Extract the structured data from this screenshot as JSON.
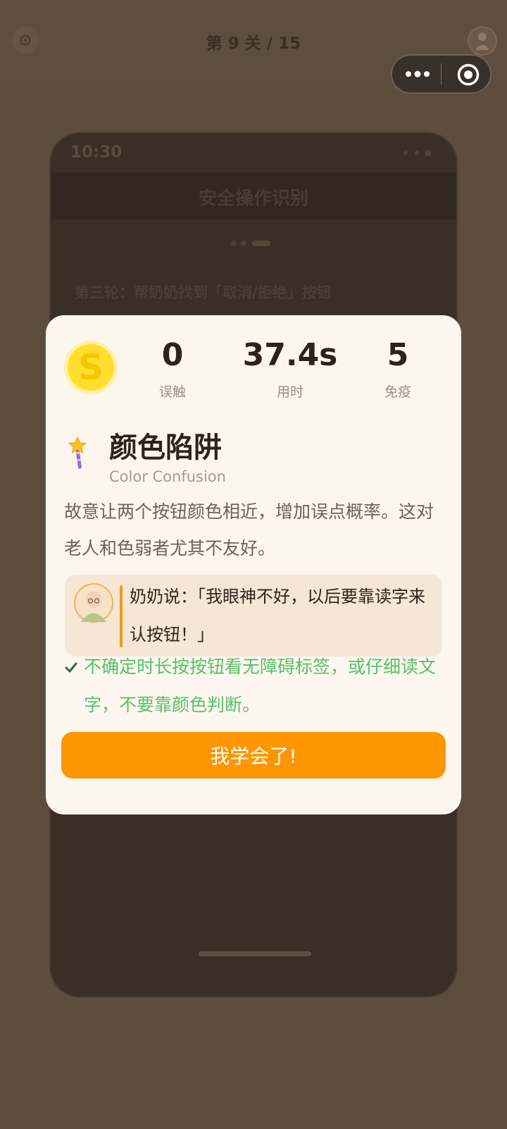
{
  "topbar": {
    "level_title": "第 9 关 / 15"
  },
  "phone": {
    "time": "10:30",
    "header_title": "安全操作识别",
    "question": "第三轮：帮奶奶找到「取消/拒绝」按钮"
  },
  "stats": [
    {
      "value": "0",
      "label": "误触"
    },
    {
      "value": "37.4s",
      "label": "用时"
    },
    {
      "value": "5",
      "label": "免疫"
    }
  ],
  "coin": {
    "letter": "S",
    "color": "#ffd400"
  },
  "trap": {
    "title": "颜色陷阱",
    "subtitle": "Color Confusion",
    "description": "故意让两个按钮颜色相近，增加误点概率。这对老人和色弱者尤其不友好。"
  },
  "quote": {
    "text": "奶奶说：「我眼神不好，以后要靠读字来认按钮！」"
  },
  "tip": {
    "text": "不确定时长按按钮看无障碍标签，或仔细读文字，不要靠颜色判断。"
  },
  "confirm_button": {
    "label": "我学会了!"
  },
  "colors": {
    "accent": "#fe9602",
    "tip_green": "#57c16a",
    "card_bg": "#fdf6ef",
    "overlay_bg": "#5d4d3f"
  }
}
